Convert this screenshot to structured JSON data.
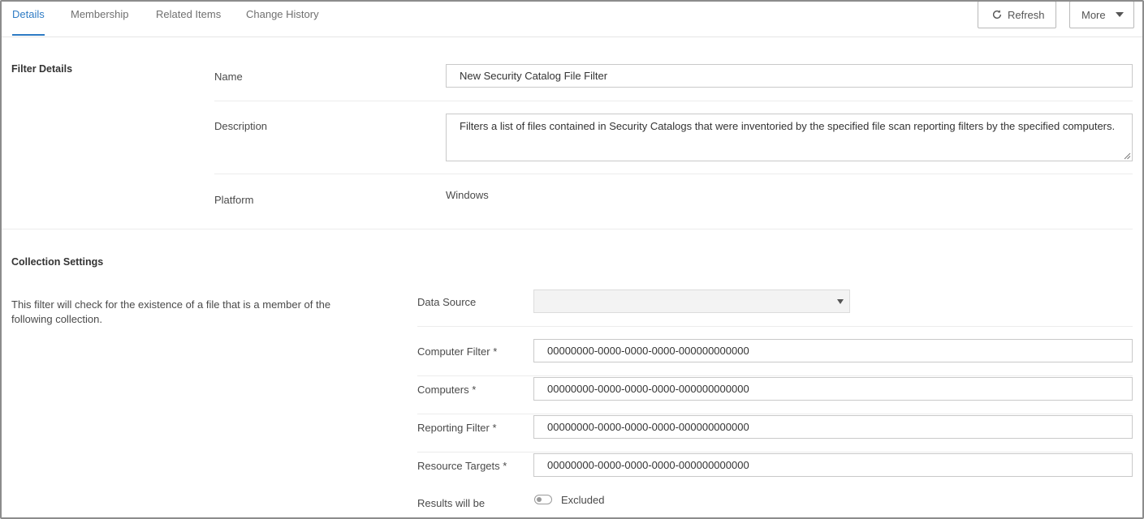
{
  "tabs": [
    {
      "label": "Details",
      "active": true
    },
    {
      "label": "Membership",
      "active": false
    },
    {
      "label": "Related Items",
      "active": false
    },
    {
      "label": "Change History",
      "active": false
    }
  ],
  "toolbar": {
    "refresh_label": "Refresh",
    "more_label": "More"
  },
  "filter_details": {
    "section_title": "Filter Details",
    "name_label": "Name",
    "name_value": "New Security Catalog File Filter",
    "description_label": "Description",
    "description_value": "Filters a list of files contained in Security Catalogs that were inventoried by the specified file scan reporting filters by the specified computers.",
    "platform_label": "Platform",
    "platform_value": "Windows"
  },
  "collection_settings": {
    "section_title": "Collection Settings",
    "description": "This filter will check for the existence of a file that is a member of the following collection.",
    "data_source_label": "Data Source",
    "data_source_value": "",
    "computer_filter_label": "Computer Filter *",
    "computer_filter_value": "00000000-0000-0000-0000-000000000000",
    "computers_label": "Computers *",
    "computers_value": "00000000-0000-0000-0000-000000000000",
    "reporting_filter_label": "Reporting Filter *",
    "reporting_filter_value": "00000000-0000-0000-0000-000000000000",
    "resource_targets_label": "Resource Targets *",
    "resource_targets_value": "00000000-0000-0000-0000-000000000000",
    "results_label": "Results will be",
    "results_value": "Excluded",
    "results_included": false
  },
  "colors": {
    "accent": "#2e7bc4",
    "border": "#c9c9c9",
    "text": "#4a4a4a"
  },
  "icons": {
    "refresh": "refresh-icon",
    "more": "chevron-down-icon",
    "data_source": "chevron-down-icon",
    "results": "toggle-switch"
  }
}
